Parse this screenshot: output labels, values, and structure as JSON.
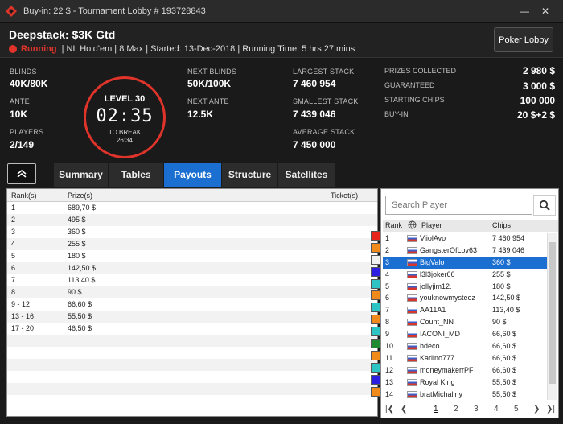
{
  "window": {
    "title": "Buy-in: 22 $ - Tournament Lobby # 193728843"
  },
  "header": {
    "name": "Deepstack: $3K Gtd",
    "status": "Running",
    "details": "| NL Hold'em | 8 Max | Started: 13-Dec-2018 | Running Time: 5 hrs  27 mins",
    "lobby_button": "Poker Lobby"
  },
  "stats": {
    "blinds_label": "BLINDS",
    "blinds": "40K/80K",
    "ante_label": "ANTE",
    "ante": "10K",
    "players_label": "PLAYERS",
    "players": "2/149",
    "next_blinds_label": "NEXT BLINDS",
    "next_blinds": "50K/100K",
    "next_ante_label": "NEXT ANTE",
    "next_ante": "12.5K",
    "largest_label": "LARGEST STACK",
    "largest": "7 460 954",
    "smallest_label": "SMALLEST STACK",
    "smallest": "7 439 046",
    "average_label": "AVERAGE STACK",
    "average": "7 450 000"
  },
  "clock": {
    "level": "LEVEL 30",
    "time": "02:35",
    "break_label": "TO BREAK",
    "break_time": "26:34"
  },
  "prizes": [
    {
      "label": "PRIZES COLLECTED",
      "value": "2 980 $"
    },
    {
      "label": "GUARANTEED",
      "value": "3 000 $"
    },
    {
      "label": "STARTING CHIPS",
      "value": "100 000"
    },
    {
      "label": "BUY-IN",
      "value": "20 $+2 $"
    }
  ],
  "tabs": [
    "Summary",
    "Tables",
    "Payouts",
    "Structure",
    "Satellites"
  ],
  "active_tab": "Payouts",
  "payouts": {
    "columns": [
      "Rank(s)",
      "Prize(s)",
      "Ticket(s)"
    ],
    "rows": [
      [
        "1",
        "689,70 $"
      ],
      [
        "2",
        "495 $"
      ],
      [
        "3",
        "360 $"
      ],
      [
        "4",
        "255 $"
      ],
      [
        "5",
        "180 $"
      ],
      [
        "6",
        "142,50 $"
      ],
      [
        "7",
        "113,40 $"
      ],
      [
        "8",
        "90 $"
      ],
      [
        "9 - 12",
        "66,60 $"
      ],
      [
        "13 - 16",
        "55,50 $"
      ],
      [
        "17 - 20",
        "46,50 $"
      ]
    ]
  },
  "players_panel": {
    "search_placeholder": "Search Player",
    "columns": [
      "Rank",
      "Player",
      "Chips"
    ],
    "rows": [
      {
        "rank": "1",
        "name": "ViiolAvo",
        "chips": "7 460 954",
        "marker": "#e8261e"
      },
      {
        "rank": "2",
        "name": "GangsterOfLov63",
        "chips": "7 439 046",
        "marker": "#f08a1a"
      },
      {
        "rank": "3",
        "name": "BigValo",
        "chips": "360 $",
        "marker": "#f0f0f0"
      },
      {
        "rank": "4",
        "name": "l3l3joker66",
        "chips": "255 $",
        "marker": "#2b1ee0"
      },
      {
        "rank": "5",
        "name": "jollyjim12.",
        "chips": "180 $",
        "marker": "#2ec4c4"
      },
      {
        "rank": "6",
        "name": "youknowmysteez",
        "chips": "142,50 $",
        "marker": "#f08a1a"
      },
      {
        "rank": "7",
        "name": "AA11A1",
        "chips": "113,40 $",
        "marker": "#2ec4c4"
      },
      {
        "rank": "8",
        "name": "Count_NN",
        "chips": "90 $",
        "marker": "#f08a1a"
      },
      {
        "rank": "9",
        "name": "IACONI_MD",
        "chips": "66,60 $",
        "marker": "#2ec4c4"
      },
      {
        "rank": "10",
        "name": "hdeco",
        "chips": "66,60 $",
        "marker": "#1f8a2e"
      },
      {
        "rank": "11",
        "name": "Karlino777",
        "chips": "66,60 $",
        "marker": "#f08a1a"
      },
      {
        "rank": "12",
        "name": "moneymakerrPF",
        "chips": "66,60 $",
        "marker": "#2ec4c4"
      },
      {
        "rank": "13",
        "name": "Royal King",
        "chips": "55,50 $",
        "marker": "#2b1ee0"
      },
      {
        "rank": "14",
        "name": "bratMichaliny",
        "chips": "55,50 $",
        "marker": "#f08a1a"
      }
    ],
    "selected_rank": "3",
    "pages": [
      "1",
      "2",
      "3",
      "4",
      "5"
    ],
    "current_page": "1"
  },
  "colors": {
    "accent": "#1a6fd0",
    "running": "#e0342b"
  }
}
